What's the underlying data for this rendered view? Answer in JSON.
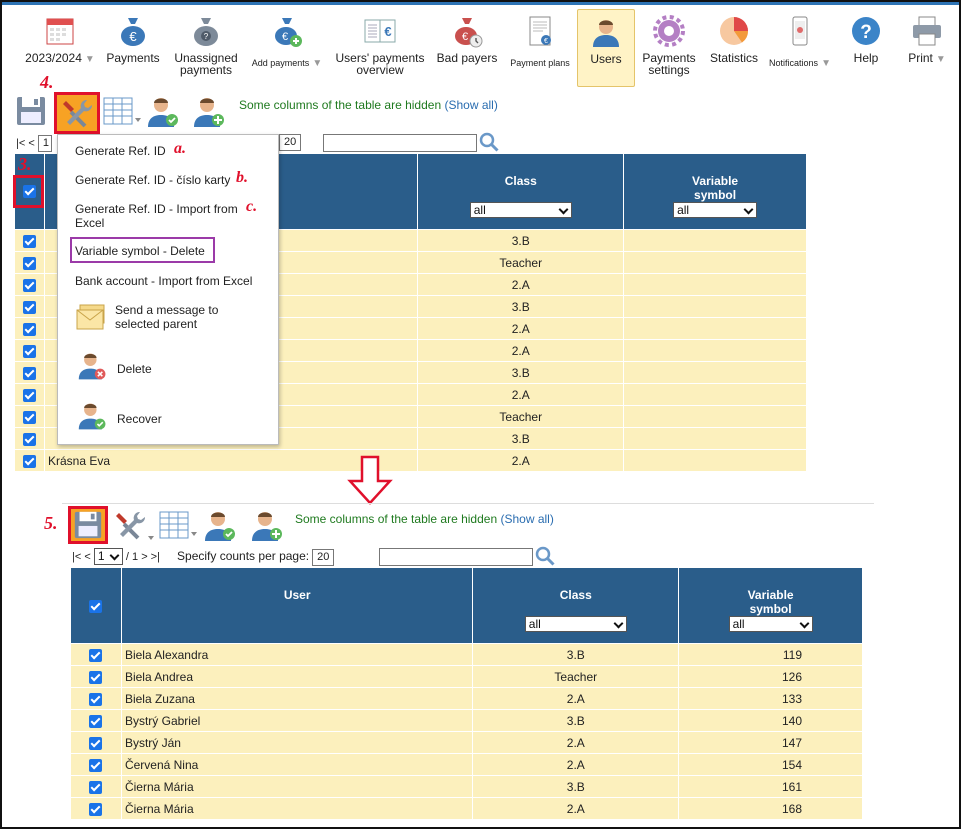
{
  "nav": {
    "items": [
      {
        "label": "2023/2024",
        "icon": "calendar-icon",
        "caret": true
      },
      {
        "label": "Payments",
        "icon": "money-bag-icon"
      },
      {
        "label": "Unassigned payments",
        "icon": "money-bag-question-icon"
      },
      {
        "label": "Add payments",
        "icon": "money-bag-add-icon",
        "caret": true,
        "small": true
      },
      {
        "label": "Users' payments overview",
        "icon": "book-euro-icon",
        "caret": true
      },
      {
        "label": "Bad payers",
        "icon": "money-bag-bad-icon"
      },
      {
        "label": "Payment plans",
        "icon": "document-euro-icon",
        "small": true
      },
      {
        "label": "Users",
        "icon": "user-icon",
        "active": true
      },
      {
        "label": "Payments settings",
        "icon": "gear-icon"
      },
      {
        "label": "Statistics",
        "icon": "pie-chart-icon"
      },
      {
        "label": "Notifications",
        "icon": "phone-icon",
        "caret": true,
        "small": true
      },
      {
        "label": "Help",
        "icon": "help-icon"
      },
      {
        "label": "Print",
        "icon": "printer-icon",
        "caret": true
      }
    ]
  },
  "top": {
    "step4": "4.",
    "step3": "3.",
    "hidden_note": "Some columns of the table are hidden",
    "show_all": "(Show all)",
    "pager_first": "|< <",
    "pager_page": "1",
    "per_page": "20",
    "columns": {
      "class": "Class",
      "vs": "Variable symbol"
    },
    "filter_all": "all",
    "rows": [
      {
        "user": "",
        "class": "3.B"
      },
      {
        "user": "",
        "class": "Teacher"
      },
      {
        "user": "",
        "class": "2.A"
      },
      {
        "user": "",
        "class": "3.B"
      },
      {
        "user": "",
        "class": "2.A"
      },
      {
        "user": "",
        "class": "2.A"
      },
      {
        "user": "",
        "class": "3.B"
      },
      {
        "user": "",
        "class": "2.A"
      },
      {
        "user": "",
        "class": "Teacher"
      },
      {
        "user": "",
        "class": "3.B"
      },
      {
        "user": "Krásna Eva",
        "class": "2.A"
      }
    ]
  },
  "menu": {
    "gen_ref": "Generate Ref. ID",
    "gen_ref_card": "Generate Ref. ID - číslo karty",
    "gen_ref_import": "Generate Ref. ID - Import from Excel",
    "vs_delete": "Variable symbol - Delete",
    "bank_import": "Bank account - Import from Excel",
    "send_message": "Send a message to selected parent",
    "delete": "Delete",
    "recover": "Recover",
    "letter_a": "a.",
    "letter_b": "b.",
    "letter_c": "c."
  },
  "bottom": {
    "step5": "5.",
    "hidden_note": "Some columns of the table are hidden",
    "show_all": "(Show all)",
    "pager_first": "|< <",
    "page": "1",
    "of_pages": "/ 1",
    "pager_last": "> >|",
    "per_page_label": "Specify counts per page:",
    "per_page": "20",
    "columns": {
      "user": "User",
      "class": "Class",
      "vs": "Variable symbol"
    },
    "filter_all": "all",
    "rows": [
      {
        "user": "Biela Alexandra",
        "class": "3.B",
        "vs": "119"
      },
      {
        "user": "Biela Andrea",
        "class": "Teacher",
        "vs": "126"
      },
      {
        "user": "Biela Zuzana",
        "class": "2.A",
        "vs": "133"
      },
      {
        "user": "Bystrý Gabriel",
        "class": "3.B",
        "vs": "140"
      },
      {
        "user": "Bystrý Ján",
        "class": "2.A",
        "vs": "147"
      },
      {
        "user": "Červená Nina",
        "class": "2.A",
        "vs": "154"
      },
      {
        "user": "Čierna Mária",
        "class": "3.B",
        "vs": "161"
      },
      {
        "user": "Čierna Mária",
        "class": "2.A",
        "vs": "168"
      }
    ]
  }
}
